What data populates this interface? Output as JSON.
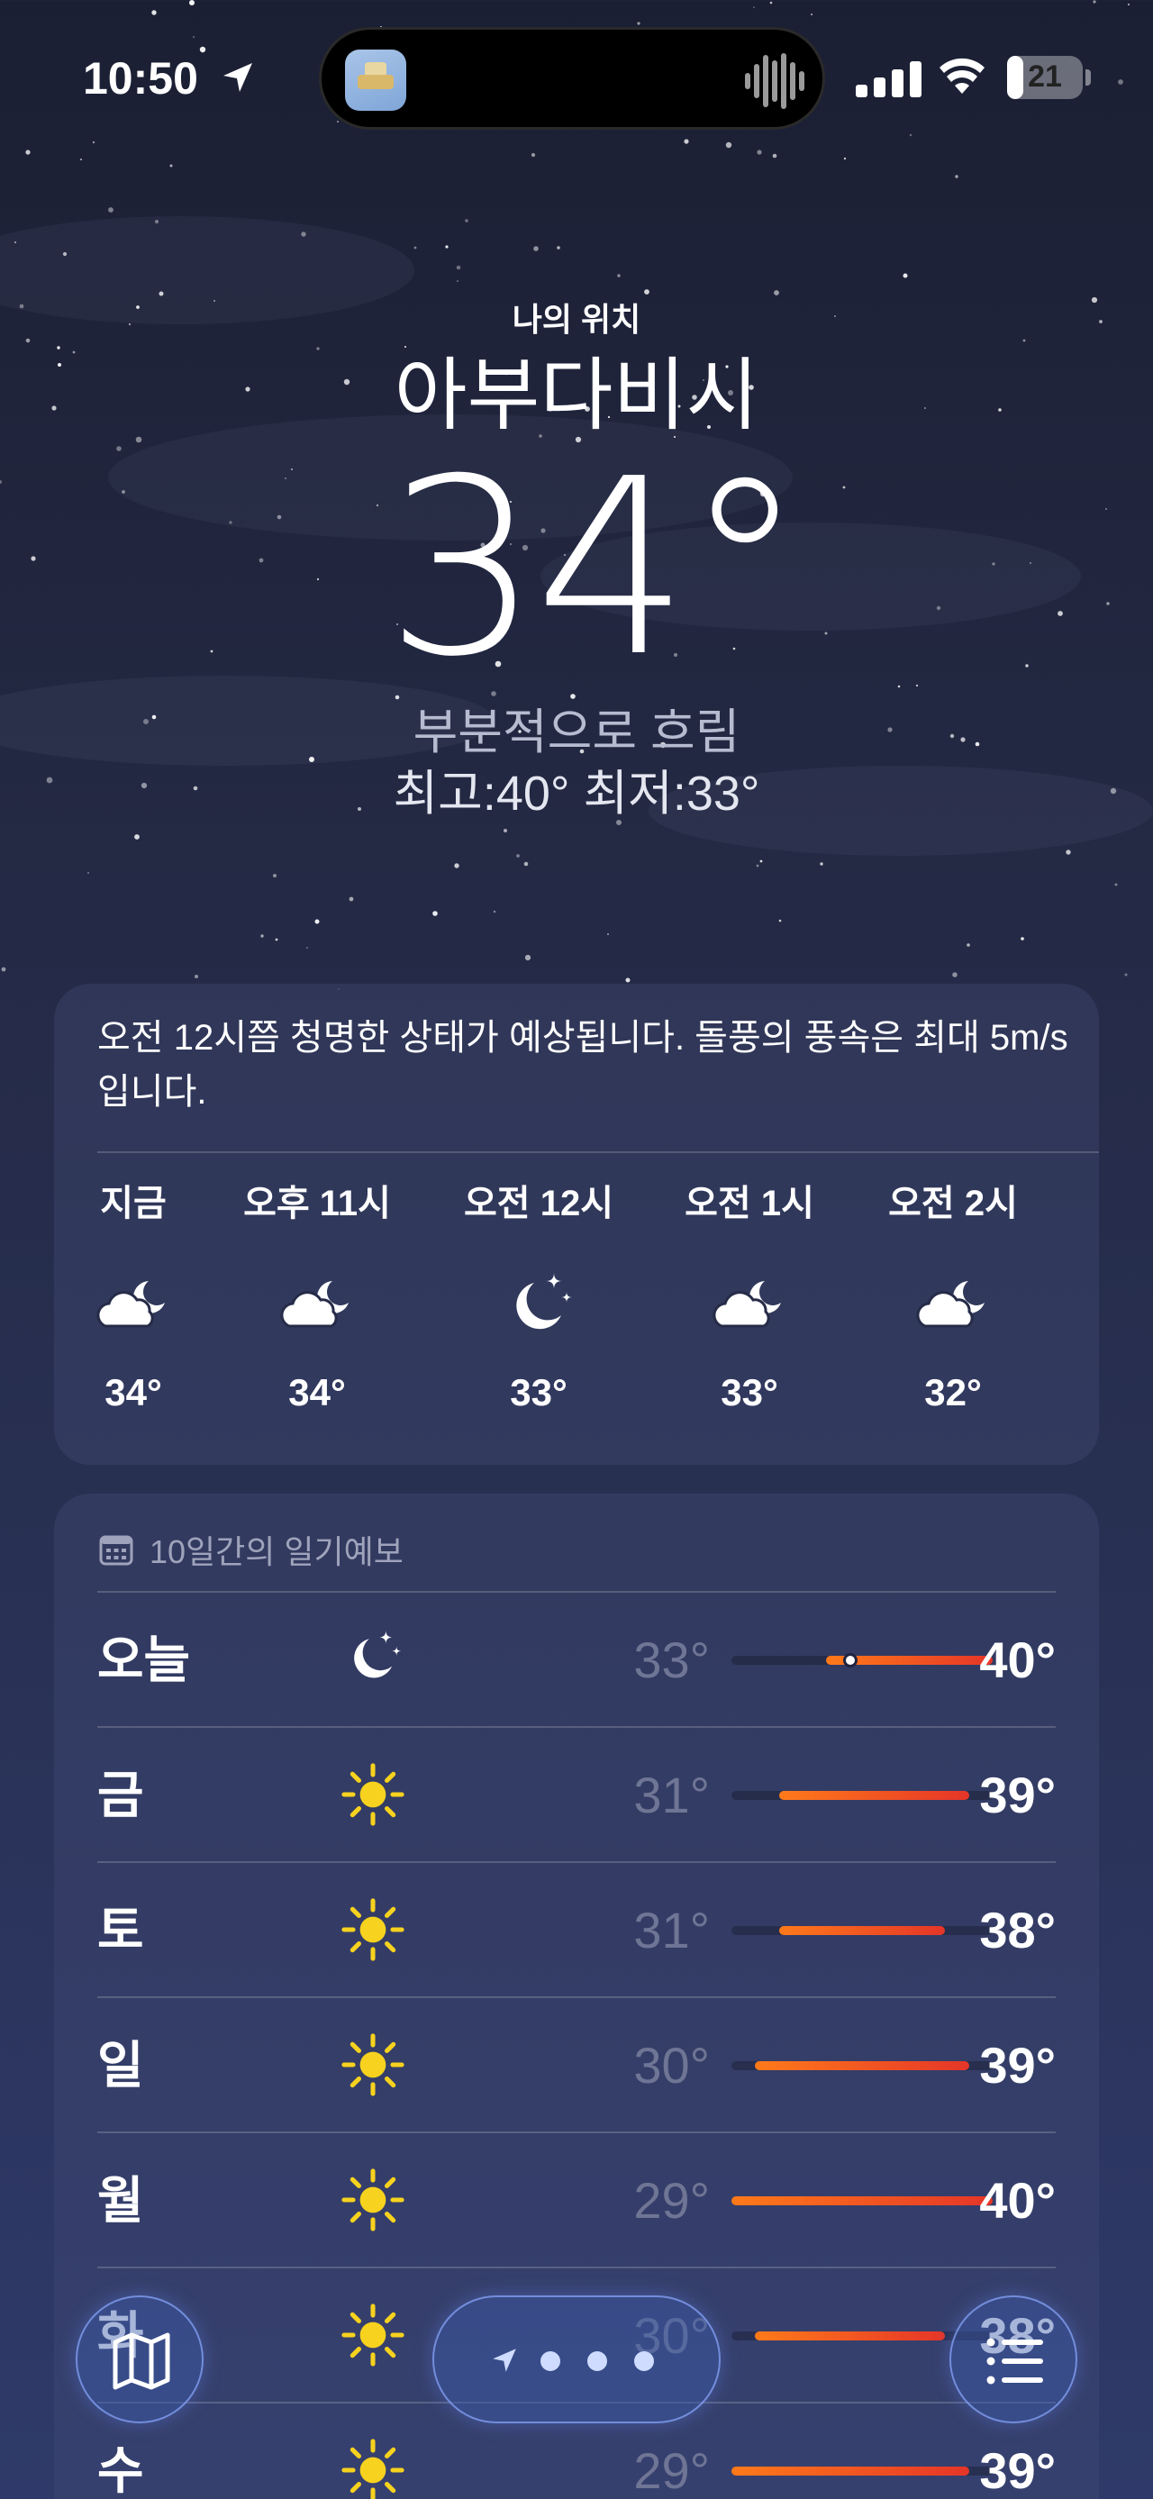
{
  "status_bar": {
    "time": "10:50",
    "battery": "21",
    "battery_level": 0.21,
    "icons": [
      "location-arrow-icon",
      "cellular-signal-icon",
      "wifi-icon",
      "battery-icon"
    ]
  },
  "dynamic_island": {
    "app_icon": "island-app-icon",
    "activity_icon": "audio-waveform-icon"
  },
  "location": {
    "label": "나의 위치",
    "city": "아부다비시",
    "temperature": "34°",
    "condition": "부분적으로 흐림",
    "high_low": "최고:40°  최저:33°"
  },
  "summary": {
    "text": "오전 12시쯤 청명한 상태가 예상됩니다. 돌풍의 풍속은 최대 5m/s입니다.",
    "hours": [
      {
        "label": "지금",
        "icon": "partly-cloudy-night-icon",
        "temp": "34°"
      },
      {
        "label": "오후 11시",
        "icon": "partly-cloudy-night-icon",
        "temp": "34°"
      },
      {
        "label": "오전 12시",
        "icon": "clear-night-icon",
        "temp": "33°"
      },
      {
        "label": "오전 1시",
        "icon": "partly-cloudy-night-icon",
        "temp": "33°"
      },
      {
        "label": "오전 2시",
        "icon": "partly-cloudy-night-icon",
        "temp": "32°"
      }
    ]
  },
  "forecast": {
    "title": "10일간의 일기예보",
    "range": [
      29,
      40
    ],
    "days": [
      {
        "day": "오늘",
        "icon": "clear-night-icon",
        "low": "33°",
        "high": "40°",
        "low_value": 33,
        "high_value": 40,
        "current": 34
      },
      {
        "day": "금",
        "icon": "sun-icon",
        "low": "31°",
        "high": "39°",
        "low_value": 31,
        "high_value": 39
      },
      {
        "day": "토",
        "icon": "sun-icon",
        "low": "31°",
        "high": "38°",
        "low_value": 31,
        "high_value": 38
      },
      {
        "day": "일",
        "icon": "sun-icon",
        "low": "30°",
        "high": "39°",
        "low_value": 30,
        "high_value": 39
      },
      {
        "day": "월",
        "icon": "sun-icon",
        "low": "29°",
        "high": "40°",
        "low_value": 29,
        "high_value": 40
      },
      {
        "day": "화",
        "icon": "sun-icon",
        "low": "30°",
        "high": "38°",
        "low_value": 30,
        "high_value": 38
      },
      {
        "day": "수",
        "icon": "sun-icon",
        "low": "29°",
        "high": "39°",
        "low_value": 29,
        "high_value": 39
      }
    ]
  },
  "toolbar": {
    "map_icon": "map-icon",
    "list_icon": "list-icon",
    "page_indicator": {
      "current_location_icon": "location-arrow-icon",
      "pages": 3
    }
  },
  "colors": {
    "background_top": "#1b1f33",
    "background_bottom": "#2f3a6a",
    "sun": "#f7d21e",
    "bar_warm": "#ff7a1a",
    "bar_hot": "#e53528"
  }
}
